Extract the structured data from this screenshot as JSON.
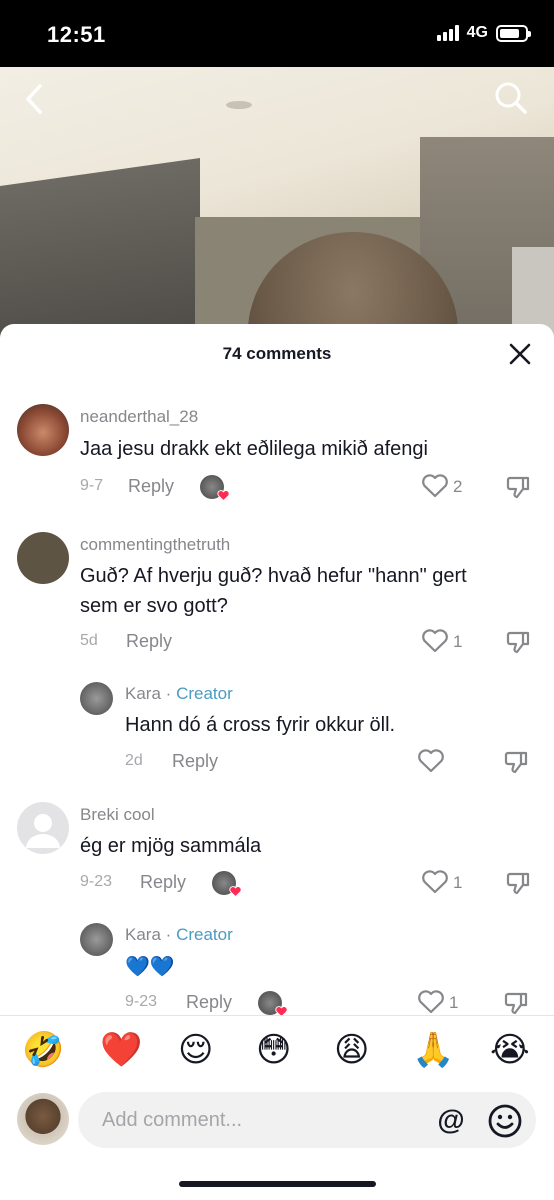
{
  "status": {
    "time": "12:51",
    "network": "4G"
  },
  "sheet": {
    "title": "74 comments"
  },
  "comments": [
    {
      "user": "neanderthal_28",
      "text": "Jaa jesu drakk ekt eðlilega mikið afengi",
      "date": "9-7",
      "reply_label": "Reply",
      "likes": "2",
      "liked_by_creator": true
    },
    {
      "user": "commentingthetruth",
      "text_line1": "Guð? Af hverju guð? hvað hefur \"hann\" gert",
      "text_line2": "sem er svo gott?",
      "date": "5d",
      "reply_label": "Reply",
      "likes": "1",
      "liked_by_creator": false
    },
    {
      "user": "Kara",
      "separator": "·",
      "badge": "Creator",
      "text": "Hann dó á cross fyrir okkur öll.",
      "date": "2d",
      "reply_label": "Reply",
      "likes": "",
      "liked_by_creator": false
    },
    {
      "user": "Breki cool",
      "text": "ég er mjög sammála",
      "date": "9-23",
      "reply_label": "Reply",
      "likes": "1",
      "liked_by_creator": true
    },
    {
      "user": "Kara",
      "separator": "·",
      "badge": "Creator",
      "text": "💙💙",
      "date": "9-23",
      "reply_label": "Reply",
      "likes": "1",
      "liked_by_creator": true
    }
  ],
  "emoji_bar": [
    "🤣",
    "❤️",
    "😌",
    "😳",
    "😩",
    "🙏",
    "😭"
  ],
  "input": {
    "placeholder": "Add comment...",
    "at_label": "@"
  },
  "colors": {
    "creator": "#4a9cc0",
    "heart": "#fe2c55",
    "text": "#161823",
    "muted": "#86878b"
  },
  "icons": [
    "back-chevron-icon",
    "search-icon",
    "close-icon",
    "heart-outline-icon",
    "thumbs-down-icon",
    "smile-icon"
  ]
}
